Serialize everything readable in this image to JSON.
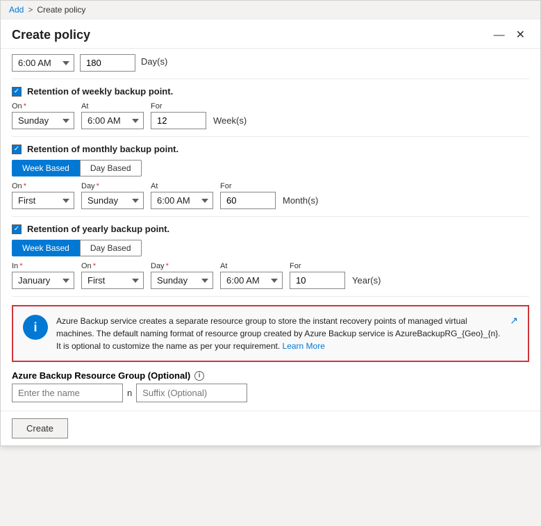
{
  "breadcrumb": {
    "add": "Add",
    "separator": ">",
    "current": "Create policy"
  },
  "title": "Create policy",
  "window_controls": {
    "minimize": "—",
    "close": "✕"
  },
  "top_row": {
    "time": "6:00 AM",
    "value": "180",
    "unit": "Day(s)"
  },
  "weekly_section": {
    "checkbox_label": "Retention of weekly backup point.",
    "on_label": "On",
    "at_label": "At",
    "for_label": "For",
    "on_value": "Sunday",
    "at_value": "6:00 AM",
    "for_value": "12",
    "unit": "Week(s)"
  },
  "monthly_section": {
    "checkbox_label": "Retention of monthly backup point.",
    "tab_week": "Week Based",
    "tab_day": "Day Based",
    "on_label": "On",
    "day_label": "Day",
    "at_label": "At",
    "for_label": "For",
    "on_value": "First",
    "day_value": "Sunday",
    "at_value": "6:00 AM",
    "for_value": "60",
    "unit": "Month(s)"
  },
  "yearly_section": {
    "checkbox_label": "Retention of yearly backup point.",
    "tab_week": "Week Based",
    "tab_day": "Day Based",
    "in_label": "In",
    "on_label": "On",
    "day_label": "Day",
    "at_label": "At",
    "for_label": "For",
    "in_value": "January",
    "on_value": "First",
    "day_value": "Sunday",
    "at_value": "6:00 AM",
    "for_value": "10",
    "unit": "Year(s)"
  },
  "info_box": {
    "text": "Azure Backup service creates a separate resource group to store the instant recovery points of managed virtual machines. The default naming format of resource group created by Azure Backup service is AzureBackupRG_{Geo}_{n}. It is optional to customize the name as per your requirement.",
    "learn_more": "Learn More"
  },
  "resource_group": {
    "label": "Azure Backup Resource Group (Optional)",
    "name_placeholder": "Enter the name",
    "separator": "n",
    "suffix_placeholder": "Suffix (Optional)"
  },
  "footer": {
    "create_label": "Create"
  }
}
